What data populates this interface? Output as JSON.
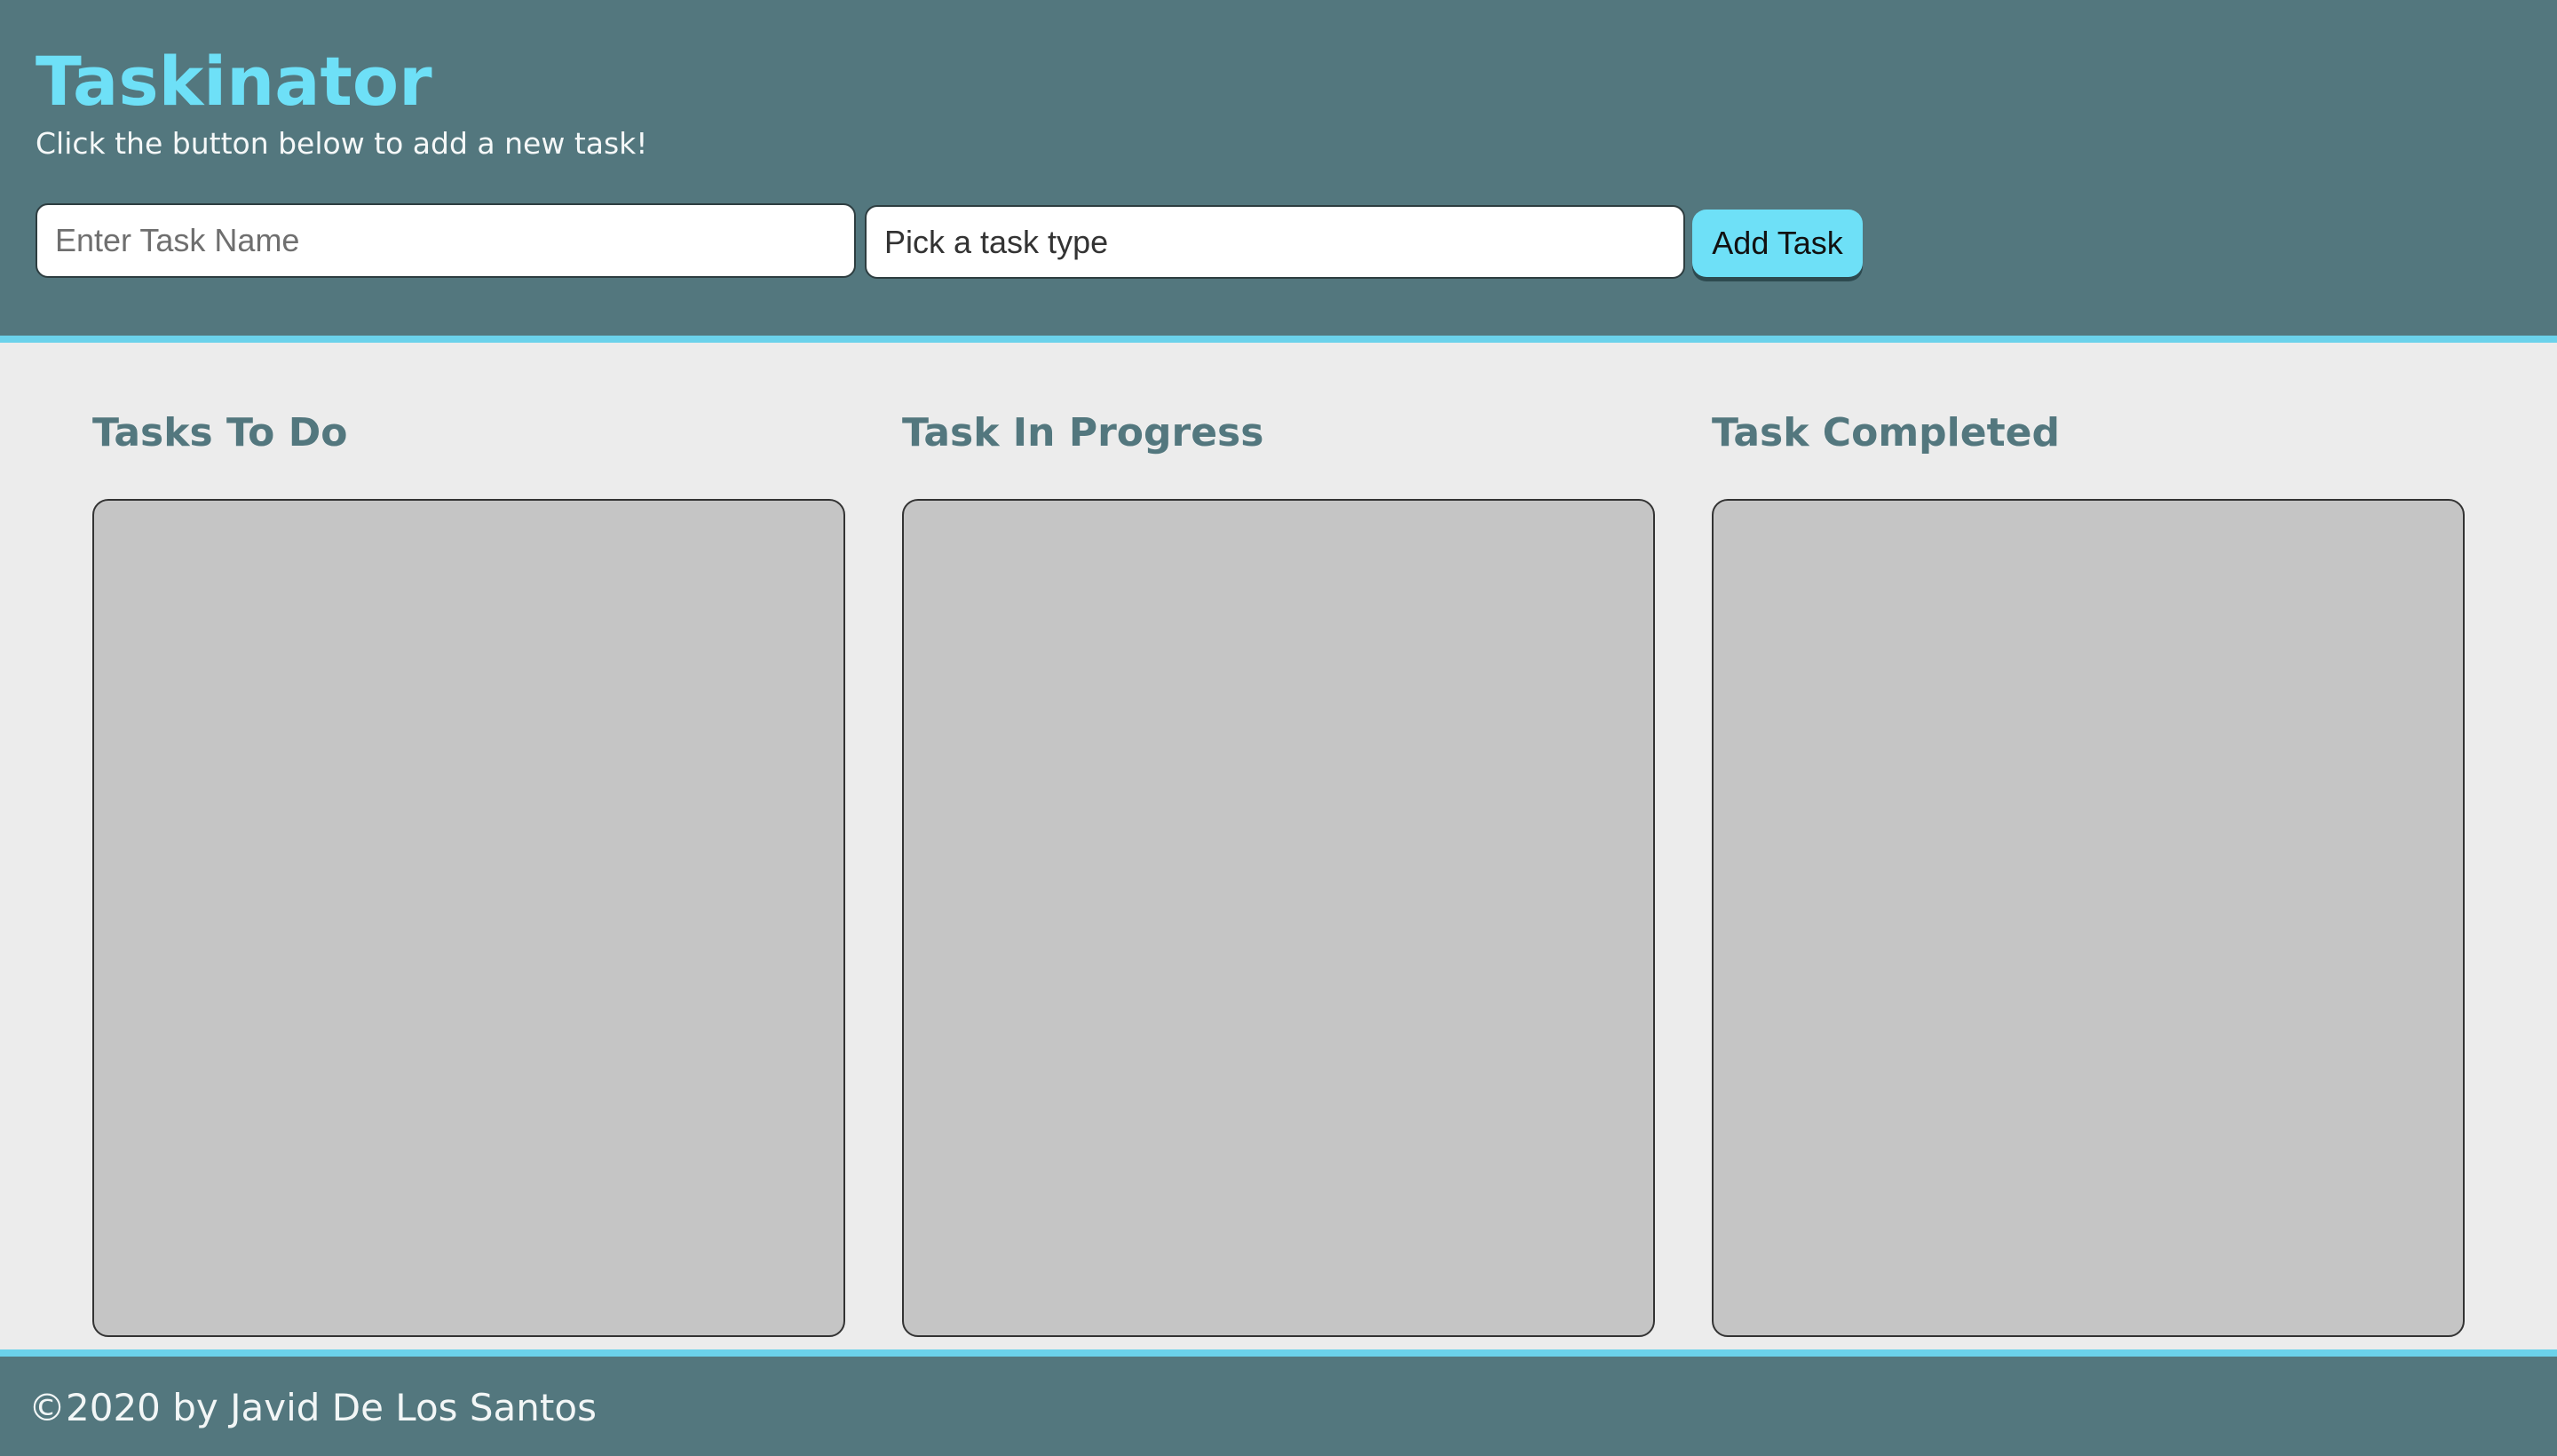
{
  "header": {
    "title": "Taskinator",
    "subtitle": "Click the button below to add a new task!"
  },
  "form": {
    "task_name_placeholder": "Enter Task Name",
    "task_name_value": "",
    "task_type_selected": "Pick a task type",
    "submit_label": "Add Task"
  },
  "columns": [
    {
      "heading": "Tasks To Do",
      "tasks": []
    },
    {
      "heading": "Task In Progress",
      "tasks": []
    },
    {
      "heading": "Task Completed",
      "tasks": []
    }
  ],
  "footer": {
    "copyright": "©2020 by Javid De Los Santos"
  },
  "colors": {
    "header_bg": "#53777e",
    "accent": "#6ee0f7",
    "page_bg": "#ececec",
    "list_bg": "#c5c5c5"
  }
}
